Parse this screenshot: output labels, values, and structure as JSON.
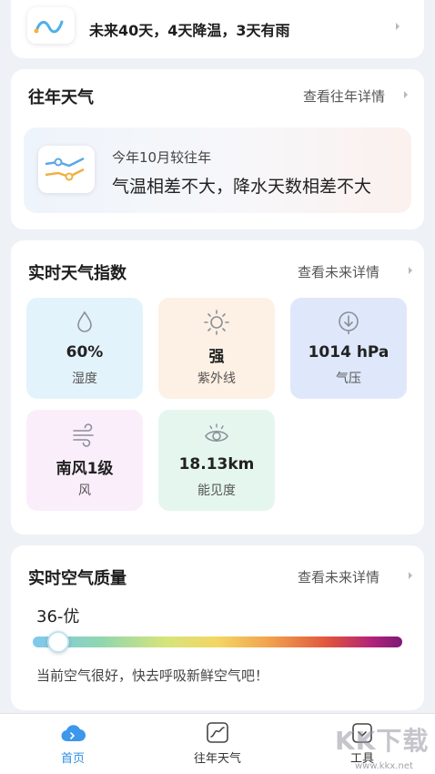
{
  "forecast": {
    "text": "未来40天，4天降温，3天有雨"
  },
  "history": {
    "title": "往年天气",
    "link": "查看往年详情",
    "subtitle": "今年10月较往年",
    "summary": "气温相差不大，降水天数相差不大"
  },
  "index": {
    "title": "实时天气指数",
    "link": "查看未来详情",
    "tiles": [
      {
        "value": "60%",
        "label": "湿度",
        "icon": "droplet-icon",
        "bg": "#e3f3fc"
      },
      {
        "value": "强",
        "label": "紫外线",
        "icon": "sun-icon",
        "bg": "#fdf0e4"
      },
      {
        "value": "1014 hPa",
        "label": "气压",
        "icon": "pressure-icon",
        "bg": "#dfe8fb"
      },
      {
        "value": "南风1级",
        "label": "风",
        "icon": "wind-icon",
        "bg": "#fbeefb"
      },
      {
        "value": "18.13km",
        "label": "能见度",
        "icon": "eye-icon",
        "bg": "#e5f6ef"
      }
    ]
  },
  "aqi": {
    "title": "实时空气质量",
    "link": "查看未来详情",
    "value": "36-优",
    "level_fraction": 0.07,
    "tip": "当前空气很好，快去呼吸新鲜空气吧！"
  },
  "nav": {
    "items": [
      {
        "label": "首页",
        "icon": "home-cloud-icon",
        "active": true
      },
      {
        "label": "往年天气",
        "icon": "chart-icon",
        "active": false
      },
      {
        "label": "工具",
        "icon": "tool-icon",
        "active": false
      }
    ]
  },
  "watermark": {
    "text": "KK下载",
    "url": "www.kkx.net"
  },
  "colors": {
    "accent": "#2e8ee6",
    "icon_stroke": "#8a8f98"
  }
}
